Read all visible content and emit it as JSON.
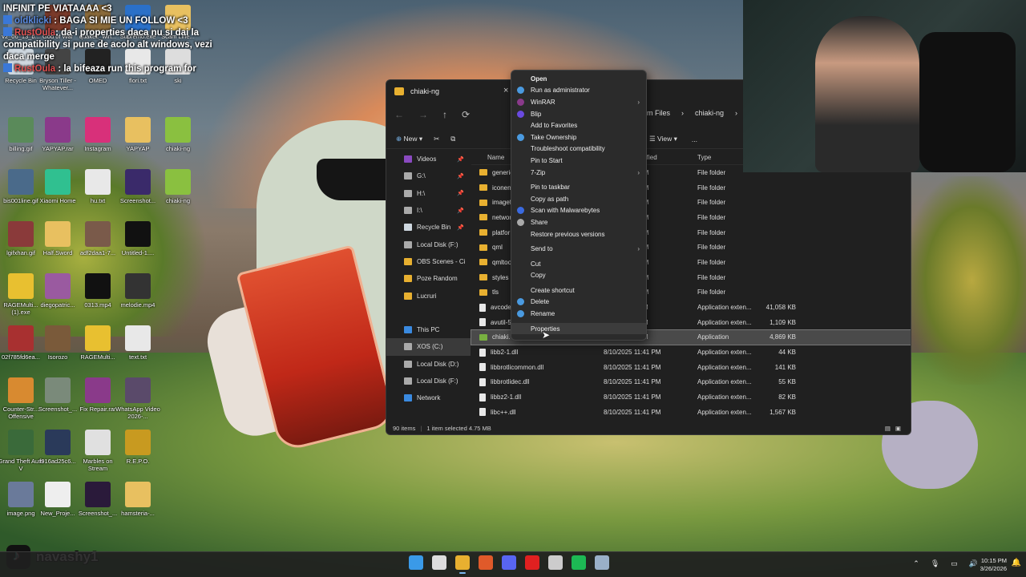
{
  "chat": [
    {
      "user": "",
      "text": "INFINIT PE VIATAAAA <3"
    },
    {
      "user": "oldklicki",
      "text": ": BAGA SI MIE UN FOLLOW <3"
    },
    {
      "user": "RustOula",
      "text": ": da-i properties daca nu si dai la compatibility si pune de acolo alt windows, vezi daca merge"
    },
    {
      "user": "RustOula",
      "text": ": la bifeaza run this program for"
    }
  ],
  "desktop_icons": [
    {
      "label": "v2_06_13_b...",
      "color": "#6b7a8a"
    },
    {
      "label": "God of War",
      "color": "#7a3a2a"
    },
    {
      "label": "quake2_win...",
      "color": "#8a6a3a"
    },
    {
      "label": "Supremo.exe",
      "color": "#2a70c8"
    },
    {
      "label": "Scam Line...",
      "color": "#e8c060"
    },
    {
      "label": "Recycle Bin",
      "color": "#cfd8e0"
    },
    {
      "label": "Bryson Tiller - Whatever...",
      "color": "#444"
    },
    {
      "label": "OMED",
      "color": "#222"
    },
    {
      "label": "flori.txt",
      "color": "#e8e8e8"
    },
    {
      "label": "ski",
      "color": "#ddd"
    },
    {
      "label": "billing.gif",
      "color": "#5a8a5a"
    },
    {
      "label": "YAPYAP.rar",
      "color": "#8a3a8a"
    },
    {
      "label": "Instagram",
      "color": "#d8307a"
    },
    {
      "label": "YAPYAP",
      "color": "#e8c060"
    },
    {
      "label": "chiaki-ng",
      "color": "#8ac040"
    },
    {
      "label": "bis001line.gif",
      "color": "#4a6a8a"
    },
    {
      "label": "Xiaomi Home",
      "color": "#30c090"
    },
    {
      "label": "hu.txt",
      "color": "#e8e8e8"
    },
    {
      "label": "Screenshot...",
      "color": "#3a2a6a"
    },
    {
      "label": "chiaki-ng",
      "color": "#8ac040"
    },
    {
      "label": "lgifxhan.gif",
      "color": "#8a3a3a"
    },
    {
      "label": "Half.Sword",
      "color": "#e8c060"
    },
    {
      "label": "adf2daa1-7...",
      "color": "#7a5a4a"
    },
    {
      "label": "Untitled-1....",
      "color": "#111"
    },
    {
      "label": "RAGEMulti... (1).exe",
      "color": "#e8c030"
    },
    {
      "label": "diegopatric...",
      "color": "#9a5aa0"
    },
    {
      "label": "0313.mp4",
      "color": "#111"
    },
    {
      "label": "melodie.mp4",
      "color": "#333"
    },
    {
      "label": "02f785fd6ea...",
      "color": "#a83030"
    },
    {
      "label": "Isorozo",
      "color": "#7a5a3a"
    },
    {
      "label": "RAGEMulti...",
      "color": "#e8c030"
    },
    {
      "label": "text.txt",
      "color": "#e8e8e8"
    },
    {
      "label": "Counter-Str... Offensive",
      "color": "#d88a30"
    },
    {
      "label": "Screenshot_...",
      "color": "#7a8a7a"
    },
    {
      "label": "Fix Repair.rar",
      "color": "#8a3a8a"
    },
    {
      "label": "WhatsApp Video 2026-...",
      "color": "#5a4a6a"
    },
    {
      "label": "Grand Theft Auto V",
      "color": "#3a6a3a"
    },
    {
      "label": "f916ad25c6...",
      "color": "#2a3a5a"
    },
    {
      "label": "Marbles on Stream",
      "color": "#e0e0e0"
    },
    {
      "label": "R.E.P.O.",
      "color": "#c89a20"
    },
    {
      "label": "image.png",
      "color": "#6a7a9a"
    },
    {
      "label": "New_Proje...",
      "color": "#eee"
    },
    {
      "label": "Screenshot_...",
      "color": "#2a1a3a"
    },
    {
      "label": "hamsteria-...",
      "color": "#e8c060"
    }
  ],
  "explorer": {
    "title": "chiaki-ng",
    "breadcrumb": [
      "am Files",
      "chiaki-ng"
    ],
    "toolbar": {
      "new": "New",
      "view": "View",
      "more": "..."
    },
    "sidebar": [
      {
        "label": "Videos",
        "pin": true,
        "color": "#8a4ac0"
      },
      {
        "label": "G:\\",
        "pin": true,
        "color": "#aaa"
      },
      {
        "label": "H:\\",
        "pin": true,
        "color": "#aaa"
      },
      {
        "label": "I:\\",
        "pin": true,
        "color": "#aaa"
      },
      {
        "label": "Recycle Bin",
        "pin": true,
        "color": "#cfd8e0"
      },
      {
        "label": "Local Disk (F:)",
        "pin": false,
        "color": "#aaa"
      },
      {
        "label": "OBS Scenes - Ci",
        "pin": false,
        "color": "#e8b030"
      },
      {
        "label": "Poze Random",
        "pin": false,
        "color": "#e8b030"
      },
      {
        "label": "Lucruri",
        "pin": false,
        "color": "#e8b030"
      },
      {
        "label": "",
        "pin": false,
        "color": ""
      },
      {
        "label": "This PC",
        "pin": false,
        "color": "#3a8ae0"
      },
      {
        "label": "XOS (C:)",
        "pin": false,
        "color": "#aaa",
        "selected": true
      },
      {
        "label": "Local Disk (D:)",
        "pin": false,
        "color": "#aaa"
      },
      {
        "label": "Local Disk (F:)",
        "pin": false,
        "color": "#aaa"
      },
      {
        "label": "Network",
        "pin": false,
        "color": "#3a8ae0"
      }
    ],
    "columns": {
      "name": "Name",
      "date": "ified",
      "type": "Type"
    },
    "rows": [
      {
        "name": "generic",
        "date": "10:14 PM",
        "type": "File folder",
        "size": "",
        "kind": "folder"
      },
      {
        "name": "iconen",
        "date": "10:14 PM",
        "type": "File folder",
        "size": "",
        "kind": "folder"
      },
      {
        "name": "imagef",
        "date": "10:14 PM",
        "type": "File folder",
        "size": "",
        "kind": "folder"
      },
      {
        "name": "networ",
        "date": "10:14 PM",
        "type": "File folder",
        "size": "",
        "kind": "folder"
      },
      {
        "name": "platfor",
        "date": "10:14 PM",
        "type": "File folder",
        "size": "",
        "kind": "folder"
      },
      {
        "name": "qml",
        "date": "10:12 PM",
        "type": "File folder",
        "size": "",
        "kind": "folder"
      },
      {
        "name": "qmltoo",
        "date": "10:14 PM",
        "type": "File folder",
        "size": "",
        "kind": "folder"
      },
      {
        "name": "styles",
        "date": "10:14 PM",
        "type": "File folder",
        "size": "",
        "kind": "folder"
      },
      {
        "name": "tls",
        "date": "10:14 PM",
        "type": "File folder",
        "size": "",
        "kind": "folder"
      },
      {
        "name": "avcode",
        "date": "11:41 PM",
        "type": "Application exten...",
        "size": "41,058 KB",
        "kind": "file"
      },
      {
        "name": "avutil-5",
        "date": "11:41 PM",
        "type": "Application exten...",
        "size": "1,109 KB",
        "kind": "file"
      },
      {
        "name": "chiaki.",
        "date": "11:41 PM",
        "type": "Application",
        "size": "4,869 KB",
        "kind": "app",
        "selected": true
      },
      {
        "name": "libb2-1.dll",
        "date": "8/10/2025 11:41 PM",
        "type": "Application exten...",
        "size": "44 KB",
        "kind": "file"
      },
      {
        "name": "libbrotlicommon.dll",
        "date": "8/10/2025 11:41 PM",
        "type": "Application exten...",
        "size": "141 KB",
        "kind": "file"
      },
      {
        "name": "libbrotlidec.dll",
        "date": "8/10/2025 11:41 PM",
        "type": "Application exten...",
        "size": "55 KB",
        "kind": "file"
      },
      {
        "name": "libbz2-1.dll",
        "date": "8/10/2025 11:41 PM",
        "type": "Application exten...",
        "size": "82 KB",
        "kind": "file"
      },
      {
        "name": "libc++.dll",
        "date": "8/10/2025 11:41 PM",
        "type": "Application exten...",
        "size": "1,567 KB",
        "kind": "file"
      }
    ],
    "status": {
      "count": "90 items",
      "selected": "1 item selected  4.75 MB"
    }
  },
  "context_menu": [
    {
      "label": "Open",
      "bold": true,
      "icon": "",
      "arrow": false
    },
    {
      "label": "Run as administrator",
      "icon": "#4a9ae0",
      "arrow": false
    },
    {
      "label": "WinRAR",
      "icon": "#8a3a8a",
      "arrow": true
    },
    {
      "label": "Blip",
      "icon": "#6a4ae0",
      "arrow": false
    },
    {
      "label": "Add to Favorites",
      "icon": "",
      "arrow": false
    },
    {
      "label": "Take Ownership",
      "icon": "#4a9ae0",
      "arrow": false
    },
    {
      "label": "Troubleshoot compatibility",
      "icon": "",
      "arrow": false
    },
    {
      "label": "Pin to Start",
      "icon": "",
      "arrow": false
    },
    {
      "label": "7-Zip",
      "icon": "",
      "arrow": true
    },
    {
      "sep": true
    },
    {
      "label": "Pin to taskbar",
      "icon": "",
      "arrow": false
    },
    {
      "label": "Copy as path",
      "icon": "",
      "arrow": false
    },
    {
      "label": "Scan with Malwarebytes",
      "icon": "#3a6ae0",
      "arrow": false
    },
    {
      "label": "Share",
      "icon": "#aaa",
      "arrow": false
    },
    {
      "label": "Restore previous versions",
      "icon": "",
      "arrow": false
    },
    {
      "sep": true
    },
    {
      "label": "Send to",
      "icon": "",
      "arrow": true
    },
    {
      "sep": true
    },
    {
      "label": "Cut",
      "icon": "",
      "arrow": false
    },
    {
      "label": "Copy",
      "icon": "",
      "arrow": false
    },
    {
      "sep": true
    },
    {
      "label": "Create shortcut",
      "icon": "",
      "arrow": false
    },
    {
      "label": "Delete",
      "icon": "#4a9ae0",
      "arrow": false
    },
    {
      "label": "Rename",
      "icon": "#4a9ae0",
      "arrow": false
    },
    {
      "sep": true
    },
    {
      "label": "Properties",
      "icon": "",
      "arrow": false,
      "hover": true
    }
  ],
  "tiktok": {
    "name": "navashy1"
  },
  "taskbar": {
    "apps": [
      {
        "name": "start-icon",
        "color": "#3a9ae8"
      },
      {
        "name": "search-icon",
        "color": "#ddd"
      },
      {
        "name": "file-explorer-icon",
        "color": "#e8b030",
        "active": true
      },
      {
        "name": "brave-icon",
        "color": "#e05a2a"
      },
      {
        "name": "discord-icon",
        "color": "#5865f2"
      },
      {
        "name": "youtube-icon",
        "color": "#e02020"
      },
      {
        "name": "chatgpt-icon",
        "color": "#ccc"
      },
      {
        "name": "spotify-icon",
        "color": "#1db954"
      },
      {
        "name": "steam-icon",
        "color": "#9ab0c8"
      }
    ],
    "time": "10:15 PM",
    "date": "3/26/2026"
  }
}
